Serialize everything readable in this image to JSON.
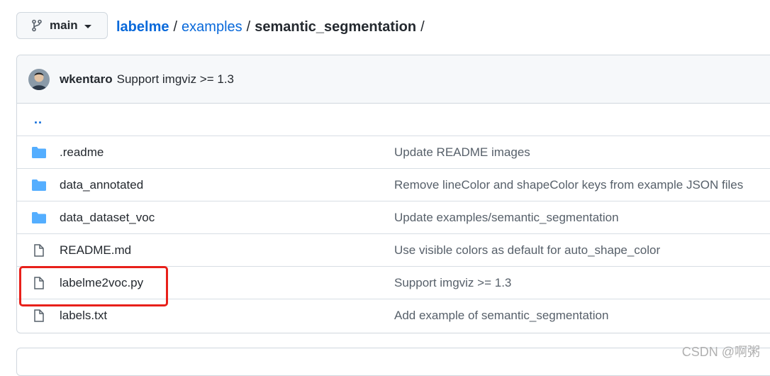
{
  "branch": {
    "label": "main",
    "icon": "git-branch-icon"
  },
  "breadcrumb": {
    "root": "labelme",
    "sep1": "/",
    "segment": "examples",
    "sep2": "/",
    "current": "semantic_segmentation",
    "sep3": "/"
  },
  "commit": {
    "author": "wkentaro",
    "message": "Support imgviz >= 1.3"
  },
  "parent_link": "..",
  "files": [
    {
      "type": "folder",
      "name": ".readme",
      "message": "Update README images"
    },
    {
      "type": "folder",
      "name": "data_annotated",
      "message": "Remove lineColor and shapeColor keys from example JSON files"
    },
    {
      "type": "folder",
      "name": "data_dataset_voc",
      "message": "Update examples/semantic_segmentation"
    },
    {
      "type": "file",
      "name": "README.md",
      "message": "Use visible colors as default for auto_shape_color"
    },
    {
      "type": "file",
      "name": "labelme2voc.py",
      "message": "Support imgviz >= 1.3"
    },
    {
      "type": "file",
      "name": "labels.txt",
      "message": "Add example of semantic_segmentation"
    }
  ],
  "colors": {
    "link": "#0969da",
    "folder": "#54aeff",
    "highlight": "#e8201a"
  },
  "watermark": "CSDN @啊粥"
}
